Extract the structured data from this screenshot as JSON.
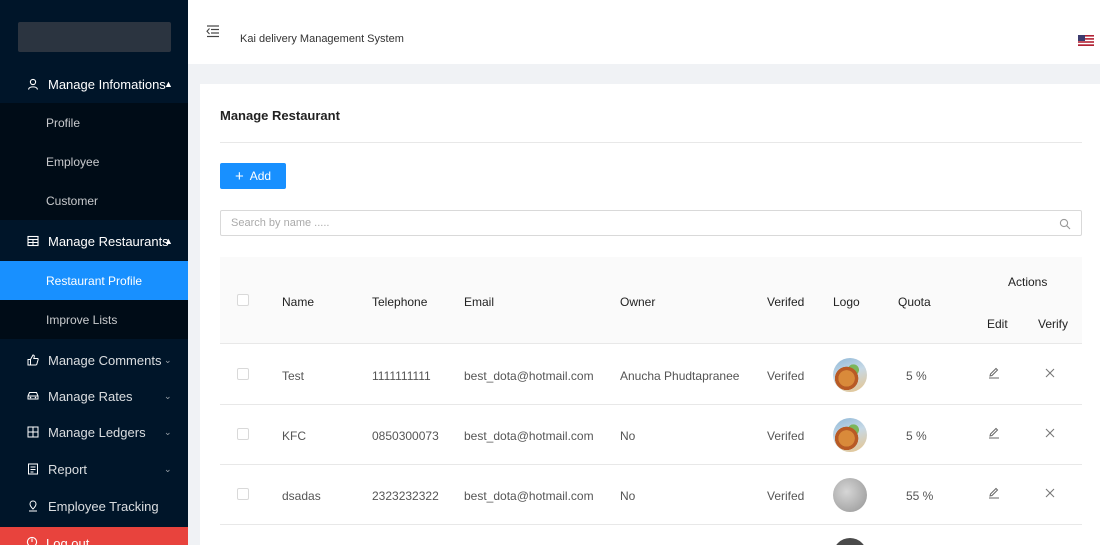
{
  "sidebar": {
    "groups": [
      {
        "label": "Manage Infomations",
        "icon": "user-icon",
        "expanded": true
      },
      {
        "label": "Manage Restaurants",
        "icon": "shop-icon",
        "expanded": true
      },
      {
        "label": "Manage Comments",
        "icon": "like-icon",
        "expanded": false
      },
      {
        "label": "Manage Rates",
        "icon": "car-icon",
        "expanded": false
      },
      {
        "label": "Manage Ledgers",
        "icon": "calculator-icon",
        "expanded": false
      },
      {
        "label": "Report",
        "icon": "report-icon",
        "expanded": false
      }
    ],
    "info_items": [
      "Profile",
      "Employee",
      "Customer"
    ],
    "restaurant_items": [
      "Restaurant Profile",
      "Improve Lists"
    ],
    "tracking": "Employee Tracking",
    "logout": "Log out",
    "active_item": "Restaurant Profile",
    "active_color": "#1890ff"
  },
  "header": {
    "title": "Kai delivery Management System"
  },
  "main": {
    "page_title": "Manage Restaurant",
    "add_label": "Add",
    "search_placeholder": "Search by name .....",
    "columns": {
      "name": "Name",
      "telephone": "Telephone",
      "email": "Email",
      "owner": "Owner",
      "verified": "Verifed",
      "logo": "Logo",
      "quota": "Quota",
      "actions": "Actions",
      "edit": "Edit",
      "verify": "Verify"
    },
    "rows": [
      {
        "name": "Test",
        "telephone": "1111111111",
        "email": "best_dota@hotmail.com",
        "owner": "Anucha Phudtapranee",
        "verified": "Verifed",
        "logo": "food-photo",
        "quota": "5 %"
      },
      {
        "name": "KFC",
        "telephone": "0850300073",
        "email": "best_dota@hotmail.com",
        "owner": "No",
        "verified": "Verifed",
        "logo": "food-photo",
        "quota": "5 %"
      },
      {
        "name": "dsadas",
        "telephone": "2323232322",
        "email": "best_dota@hotmail.com",
        "owner": "No",
        "verified": "Verifed",
        "logo": "gray-photo",
        "quota": "55 %"
      }
    ]
  },
  "colors": {
    "sidebar_bg": "#001529",
    "primary": "#1890ff",
    "logout": "#e8433d"
  }
}
